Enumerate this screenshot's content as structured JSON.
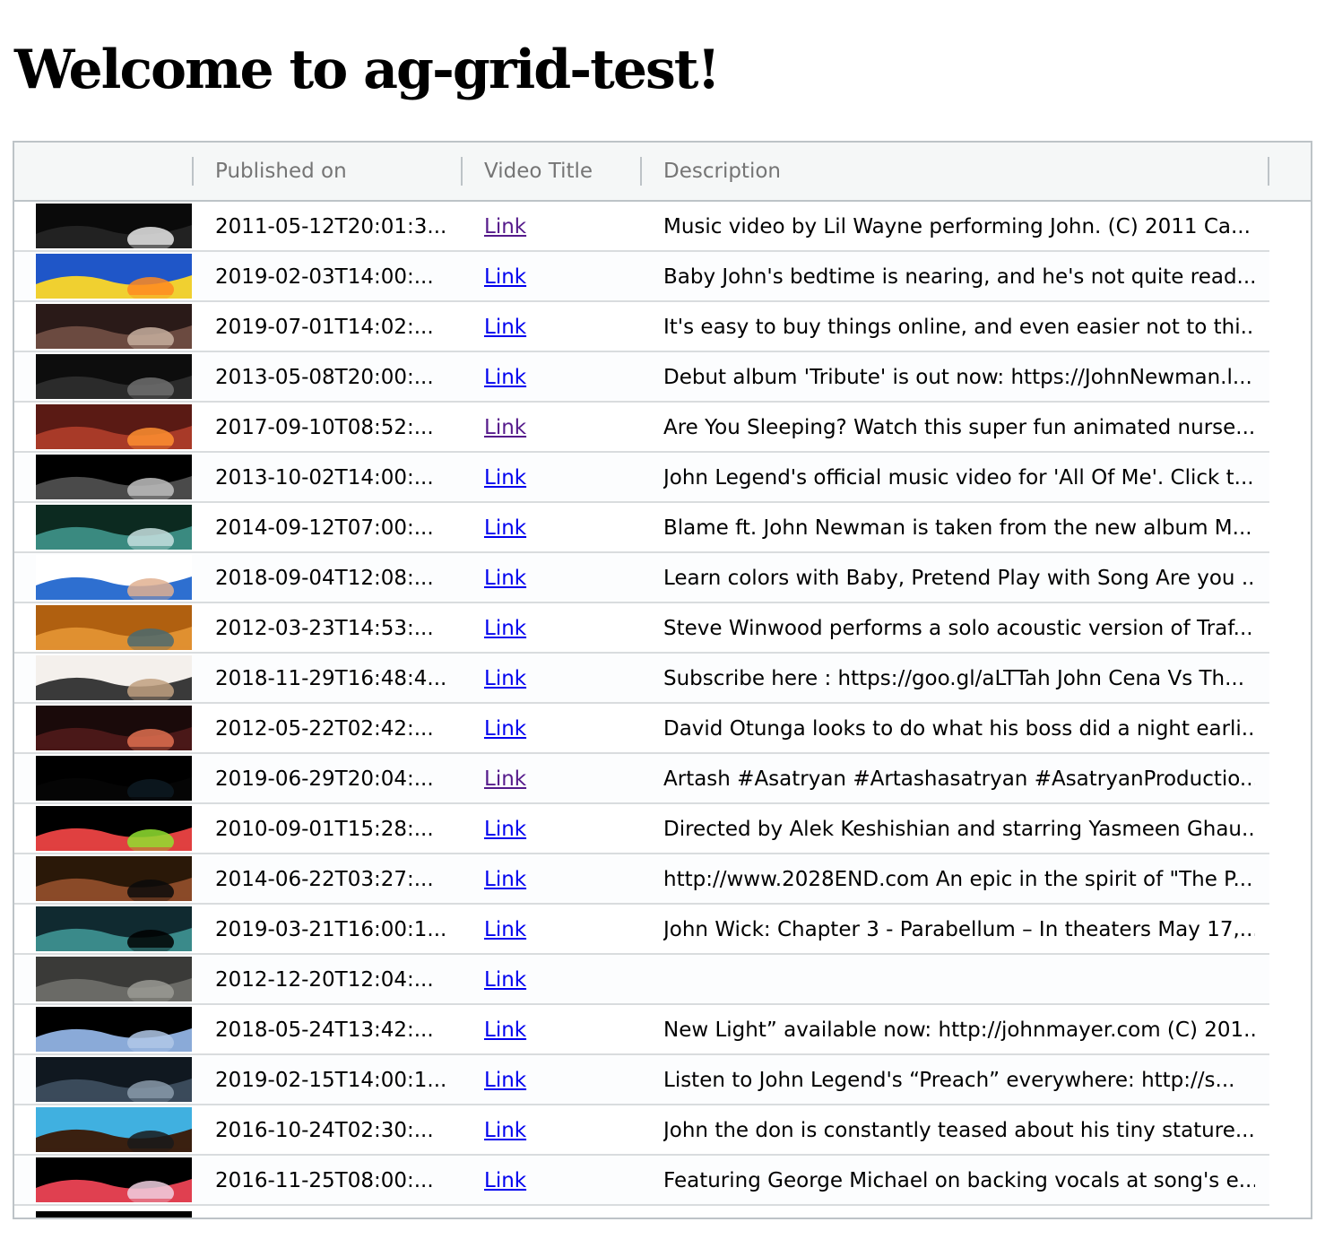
{
  "page": {
    "title": "Welcome to ag-grid-test!"
  },
  "grid": {
    "columns": [
      "",
      "Published on",
      "Video Title",
      "Description"
    ],
    "rows": [
      {
        "published": "2011-05-12T20:01:3...",
        "link": "Link",
        "visited": true,
        "description": "Music video by Lil Wayne performing John. (C) 2011 Ca...",
        "thumb_colors": [
          "#0a0a0a",
          "#222222",
          "#e8e8e8"
        ]
      },
      {
        "published": "2019-02-03T14:00:...",
        "link": "Link",
        "visited": false,
        "description": "Baby John's bedtime is nearing, and he's not quite read...",
        "thumb_colors": [
          "#1f56c8",
          "#f0d030",
          "#ff8a20"
        ]
      },
      {
        "published": "2019-07-01T14:02:...",
        "link": "Link",
        "visited": false,
        "description": "It's easy to buy things online, and even easier not to thi...",
        "thumb_colors": [
          "#2a1a18",
          "#6b4a40",
          "#c8b0a0"
        ]
      },
      {
        "published": "2013-05-08T20:00:...",
        "link": "Link",
        "visited": false,
        "description": "Debut album 'Tribute' is out now: https://JohnNewman.l...",
        "thumb_colors": [
          "#0d0d0d",
          "#2b2b2b",
          "#707070"
        ]
      },
      {
        "published": "2017-09-10T08:52:...",
        "link": "Link",
        "visited": true,
        "description": "Are You Sleeping? Watch this super fun animated nurse...",
        "thumb_colors": [
          "#5a1a14",
          "#a83a28",
          "#ff9030"
        ]
      },
      {
        "published": "2013-10-02T14:00:...",
        "link": "Link",
        "visited": false,
        "description": "John Legend's official music video for 'All Of Me'. Click t...",
        "thumb_colors": [
          "#000000",
          "#4a4a4a",
          "#bfbfbf"
        ]
      },
      {
        "published": "2014-09-12T07:00:...",
        "link": "Link",
        "visited": false,
        "description": "Blame ft. John Newman is taken from the new album M...",
        "thumb_colors": [
          "#0c2a20",
          "#3a8a80",
          "#c8e0e0"
        ]
      },
      {
        "published": "2018-09-04T12:08:...",
        "link": "Link",
        "visited": false,
        "description": "Learn colors with Baby, Pretend Play with Song Are you ...",
        "thumb_colors": [
          "#ffffff",
          "#2e6fd0",
          "#e0b090"
        ]
      },
      {
        "published": "2012-03-23T14:53:...",
        "link": "Link",
        "visited": false,
        "description": "Steve Winwood performs a solo acoustic version of Traf...",
        "thumb_colors": [
          "#b06010",
          "#e09030",
          "#4a6a70"
        ]
      },
      {
        "published": "2018-11-29T16:48:4...",
        "link": "Link",
        "visited": false,
        "description": "Subscribe here : https://goo.gl/aLTTah John Cena Vs Th...",
        "thumb_colors": [
          "#f4f0ec",
          "#3a3a3a",
          "#c0a080"
        ]
      },
      {
        "published": "2012-05-22T02:42:...",
        "link": "Link",
        "visited": false,
        "description": "David Otunga looks to do what his boss did a night earli...",
        "thumb_colors": [
          "#1a0a0a",
          "#4a1818",
          "#e07050"
        ]
      },
      {
        "published": "2019-06-29T20:04:...",
        "link": "Link",
        "visited": true,
        "description": "Artash #Asatryan #Artashasatryan #AsatryanProductio...",
        "thumb_colors": [
          "#000000",
          "#050505",
          "#0d1a22"
        ]
      },
      {
        "published": "2010-09-01T15:28:...",
        "link": "Link",
        "visited": false,
        "description": "Directed by Alek Keshishian and starring Yasmeen Ghau...",
        "thumb_colors": [
          "#000000",
          "#e04040",
          "#90e030"
        ]
      },
      {
        "published": "2014-06-22T03:27:...",
        "link": "Link",
        "visited": false,
        "description": "http://www.2028END.com An epic in the spirit of \"The P...",
        "thumb_colors": [
          "#2a1808",
          "#8a4a28",
          "#0a0a0a"
        ]
      },
      {
        "published": "2019-03-21T16:00:1...",
        "link": "Link",
        "visited": false,
        "description": "John Wick: Chapter 3 - Parabellum – In theaters May 17,...",
        "thumb_colors": [
          "#102a30",
          "#3a8a8a",
          "#000000"
        ]
      },
      {
        "published": "2012-12-20T12:04:...",
        "link": "Link",
        "visited": false,
        "description": "",
        "thumb_colors": [
          "#3a3a38",
          "#6a6a66",
          "#9a9a94"
        ]
      },
      {
        "published": "2018-05-24T13:42:...",
        "link": "Link",
        "visited": false,
        "description": "New Light” available now: http://johnmayer.com (C) 201...",
        "thumb_colors": [
          "#000000",
          "#8aaad8",
          "#b0c8e8"
        ]
      },
      {
        "published": "2019-02-15T14:00:1...",
        "link": "Link",
        "visited": false,
        "description": "Listen to John Legend's “Preach” everywhere: http://s...",
        "thumb_colors": [
          "#101820",
          "#3a4a5a",
          "#8a9aaa"
        ]
      },
      {
        "published": "2016-10-24T02:30:...",
        "link": "Link",
        "visited": false,
        "description": "John the don is constantly teased about his tiny stature...",
        "thumb_colors": [
          "#40b0e0",
          "#3a2010",
          "#1a1a1a"
        ]
      },
      {
        "published": "2016-11-25T08:00:...",
        "link": "Link",
        "visited": false,
        "description": "Featuring George Michael on backing vocals at song's e...",
        "thumb_colors": [
          "#000000",
          "#e04050",
          "#f0d0e0"
        ]
      }
    ]
  }
}
